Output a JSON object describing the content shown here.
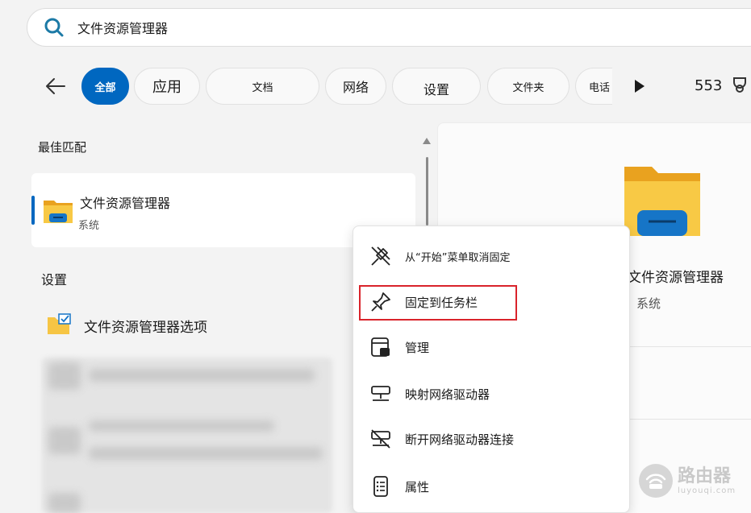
{
  "search": {
    "value": "文件资源管理器"
  },
  "filters": {
    "chips": [
      {
        "label": "全部",
        "active": true
      },
      {
        "label": "应用"
      },
      {
        "label": "文档"
      },
      {
        "label": "网络"
      },
      {
        "label": "设置"
      },
      {
        "label": "文件夹"
      },
      {
        "label": "电话"
      }
    ],
    "points": "553"
  },
  "left_panel": {
    "best_match_title": "最佳匹配",
    "best_match": {
      "title": "文件资源管理器",
      "subtitle": "系统"
    },
    "settings_title": "设置",
    "settings_item": "文件资源管理器选项"
  },
  "detail": {
    "title": "文件资源管理器",
    "subtitle": "系统"
  },
  "context_menu": {
    "items": [
      {
        "label": "从“开始”菜单取消固定",
        "icon": "unpin-icon"
      },
      {
        "label": "固定到任务栏",
        "icon": "pin-icon"
      },
      {
        "label": "管理",
        "icon": "manage-icon"
      },
      {
        "label": "映射网络驱动器",
        "icon": "network-drive-icon"
      },
      {
        "label": "断开网络驱动器连接",
        "icon": "disconnect-drive-icon"
      },
      {
        "label": "属性",
        "icon": "properties-icon"
      }
    ]
  },
  "watermark": {
    "main": "路由器",
    "sub": "luyouqi.com"
  },
  "colors": {
    "accent": "#0067c0",
    "highlight": "#d9232b",
    "folder": "#f5c542"
  }
}
